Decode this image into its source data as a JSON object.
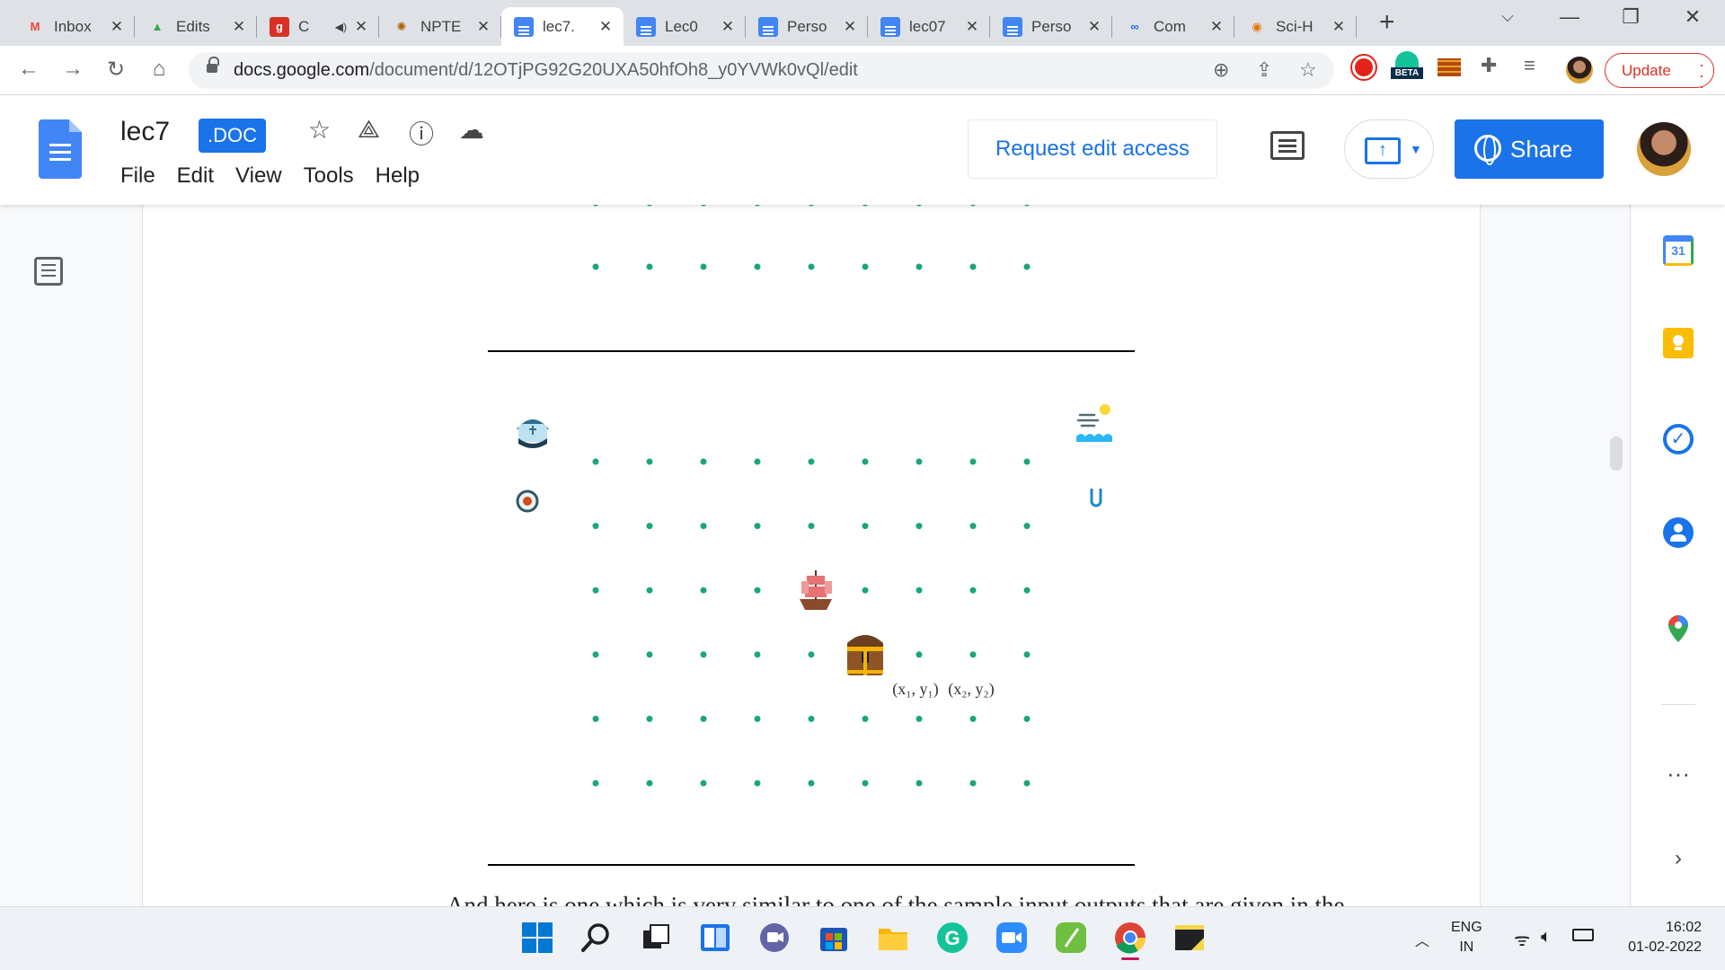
{
  "browser": {
    "tabs": [
      {
        "title": "Inbox",
        "favicon": "gmail-icon",
        "fav_text": "M",
        "fav_color": "#ea4335",
        "active": false
      },
      {
        "title": "Edits",
        "favicon": "drive-icon",
        "fav_text": "▲",
        "fav_color": "#34a853",
        "active": false
      },
      {
        "title": "C",
        "favicon": "g-app-icon",
        "fav_text": "g",
        "fav_color": "#d93025",
        "active": false,
        "audio": true
      },
      {
        "title": "NPTE",
        "favicon": "nptel-icon",
        "fav_text": "✺",
        "fav_color": "#b06000",
        "active": false
      },
      {
        "title": "lec7.",
        "favicon": "docs-icon",
        "fav_text": "",
        "fav_color": "#4285f4",
        "active": true
      },
      {
        "title": "Lec0",
        "favicon": "docs-icon",
        "fav_text": "",
        "fav_color": "#4285f4",
        "active": false
      },
      {
        "title": "Perso",
        "favicon": "docs-icon",
        "fav_text": "",
        "fav_color": "#4285f4",
        "active": false
      },
      {
        "title": "lec07",
        "favicon": "docs-icon",
        "fav_text": "",
        "fav_color": "#4285f4",
        "active": false
      },
      {
        "title": "Perso",
        "favicon": "docs-icon",
        "fav_text": "",
        "fav_color": "#4285f4",
        "active": false
      },
      {
        "title": "Com",
        "favicon": "link-icon",
        "fav_text": "∞",
        "fav_color": "#1a73e8",
        "active": false
      },
      {
        "title": "Sci-H",
        "favicon": "scihub-icon",
        "fav_text": "◉",
        "fav_color": "#e37400",
        "active": false
      }
    ],
    "url_host": "docs.google.com",
    "url_path": "/document/d/12OTjPG92G20UXA50hfOh8_y0YVWk0vQl/edit",
    "update_label": "Update",
    "beta_label": "BETA"
  },
  "docs": {
    "title": "lec7",
    "badge": ".DOC",
    "menu": [
      "File",
      "Edit",
      "View",
      "Tools",
      "Help"
    ],
    "request_edit_label": "Request edit access",
    "share_label": "Share"
  },
  "figure": {
    "top_rows_partial": 2,
    "grid_cols": 9,
    "grid_rows": 6,
    "dot_color": "#1aa67a",
    "label_1": "(x₁, y₁)",
    "label_2": "(x₂, y₂)",
    "icons": [
      "captain-hat-icon",
      "weather-wind-icon",
      "compass-icon",
      "magnet-icon",
      "pirate-ship-icon",
      "treasure-chest-icon"
    ]
  },
  "document": {
    "body_text": "And here is one which is very similar to one of the sample input outputs that are given in the"
  },
  "sidepanel": {
    "calendar_day": "31"
  },
  "taskbar": {
    "language": "ENG",
    "region": "IN",
    "time": "16:02",
    "date": "01-02-2022"
  }
}
